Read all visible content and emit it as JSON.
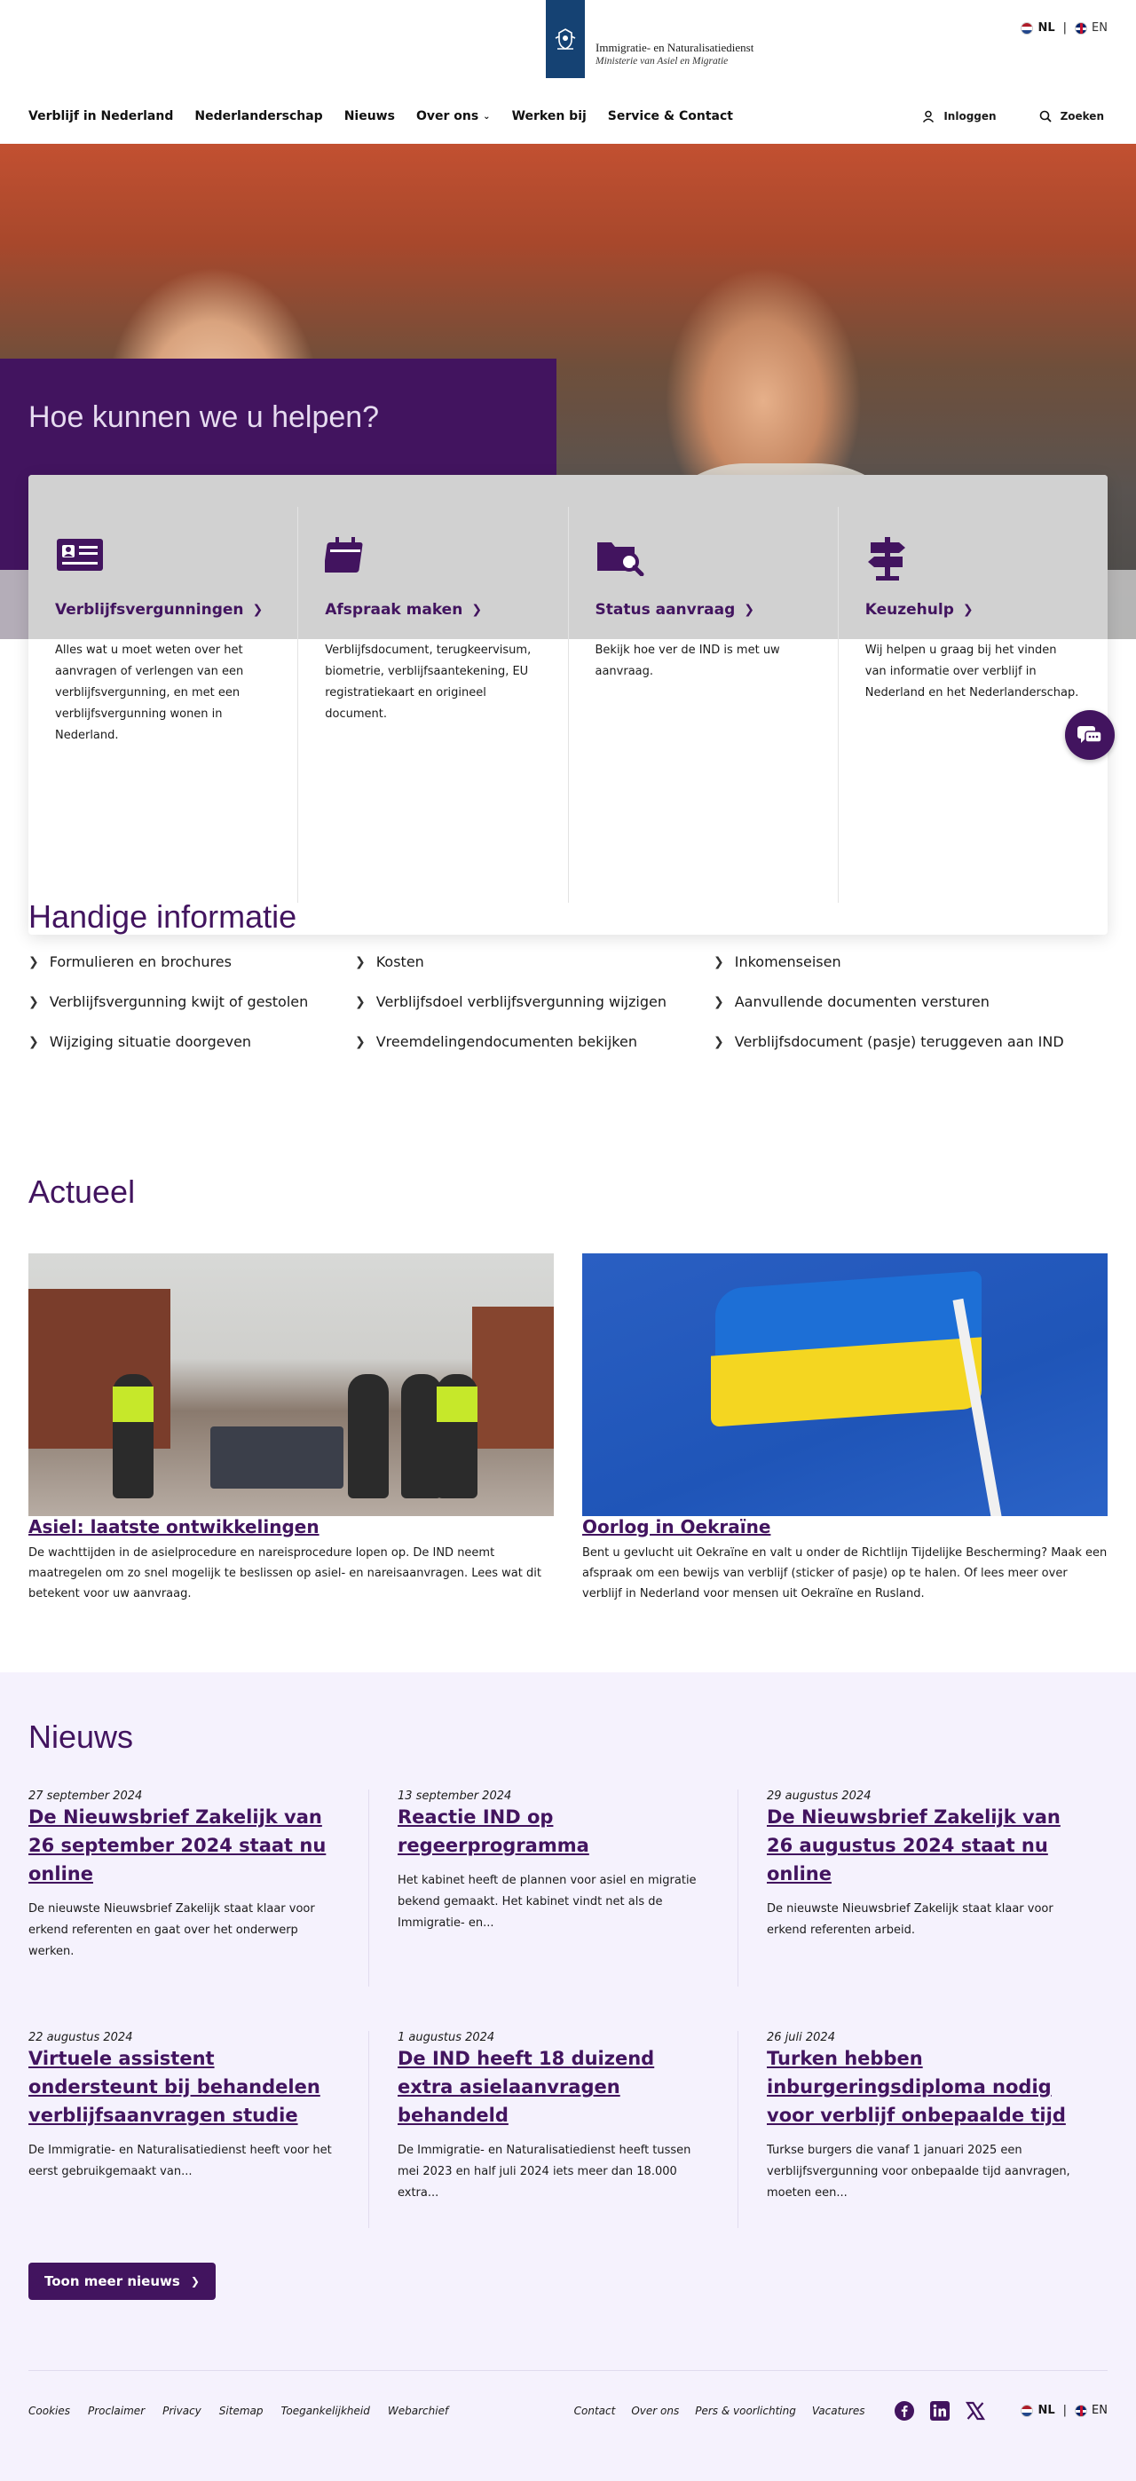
{
  "header": {
    "logo_line1": "Immigratie- en Naturalisatiedienst",
    "logo_line2": "Ministerie van Asiel en Migratie",
    "lang_nl": "NL",
    "lang_en": "EN"
  },
  "nav": {
    "items": [
      "Verblijf in Nederland",
      "Nederlanderschap",
      "Nieuws",
      "Over ons",
      "Werken bij",
      "Service & Contact"
    ],
    "login": "Inloggen",
    "search": "Zoeken"
  },
  "hero": {
    "title": "Hoe kunnen we u helpen?"
  },
  "cards": [
    {
      "title": "Verblijfsvergunningen",
      "desc": "Alles wat u moet weten over het aanvragen of verlengen van een verblijfsvergunning, en met een verblijfsvergunning wonen in Nederland.",
      "icon": "id-card-icon"
    },
    {
      "title": "Afspraak maken",
      "desc": "Verblijfsdocument, terugkeervisum, biometrie, verblijfsaantekening, EU registratiekaart en origineel document.",
      "icon": "calendar-icon"
    },
    {
      "title": "Status aanvraag",
      "desc": "Bekijk hoe ver de IND is met uw aanvraag.",
      "icon": "folder-search-icon"
    },
    {
      "title": "Keuzehulp",
      "desc": "Wij helpen u graag bij het vinden van informatie over verblijf in Nederland en het Nederlanderschap.",
      "icon": "signpost-icon"
    }
  ],
  "handig": {
    "title": "Handige informatie",
    "links": [
      "Formulieren en brochures",
      "Kosten",
      "Inkomenseisen",
      "Verblijfsvergunning kwijt of gestolen",
      "Verblijfsdoel verblijfsvergunning wijzigen",
      "Aanvullende documenten versturen",
      "Wijziging situatie doorgeven",
      "Vreemdelingendocumenten bekijken",
      "Verblijfsdocument (pasje) teruggeven aan IND"
    ]
  },
  "actueel": {
    "title": "Actueel",
    "items": [
      {
        "title": "Asiel: laatste ontwikkelingen",
        "desc": "De wachttijden in de asielprocedure en nareisprocedure lopen op. De IND neemt maatregelen om zo snel mogelijk te beslissen op asiel- en nareisaanvragen. Lees wat dit betekent voor uw aanvraag."
      },
      {
        "title": "Oorlog in Oekraïne",
        "desc": "Bent u gevlucht uit Oekraïne en valt u onder de Richtlijn Tijdelijke Bescherming? Maak een afspraak om een bewijs van verblijf (sticker of pasje) op te halen. Of lees meer over verblijf in Nederland voor mensen uit Oekraïne en Rusland."
      }
    ]
  },
  "nieuws": {
    "title": "Nieuws",
    "items": [
      {
        "date": "27 september 2024",
        "title": "De Nieuwsbrief Zakelijk van 26 september 2024 staat nu online",
        "desc": "De nieuwste Nieuwsbrief Zakelijk staat klaar voor erkend referenten en gaat over het onderwerp werken."
      },
      {
        "date": "13 september 2024",
        "title": "Reactie IND op regeerprogramma",
        "desc": "Het kabinet heeft de plannen voor asiel en migratie bekend gemaakt. Het kabinet vindt net als de Immigratie- en..."
      },
      {
        "date": "29 augustus 2024",
        "title": "De Nieuwsbrief Zakelijk van 26 augustus 2024 staat nu online",
        "desc": "De nieuwste Nieuwsbrief Zakelijk staat klaar voor erkend referenten arbeid."
      },
      {
        "date": "22 augustus 2024",
        "title": "Virtuele assistent ondersteunt bij behandelen verblijfsaanvragen studie",
        "desc": "De Immigratie- en Naturalisatiedienst heeft voor het eerst gebruikgemaakt van..."
      },
      {
        "date": "1 augustus 2024",
        "title": "De IND heeft 18 duizend extra asielaanvragen behandeld",
        "desc": "De Immigratie- en Naturalisatiedienst heeft tussen mei 2023 en half juli 2024 iets meer dan 18.000 extra..."
      },
      {
        "date": "26 juli 2024",
        "title": "Turken hebben inburgeringsdiploma nodig voor verblijf onbepaalde tijd",
        "desc": "Turkse burgers die vanaf 1 januari 2025 een verblijfsvergunning voor onbepaalde tijd aanvragen, moeten een..."
      }
    ],
    "more_label": "Toon meer nieuws"
  },
  "footer": {
    "left": [
      "Cookies",
      "Proclaimer",
      "Privacy",
      "Sitemap",
      "Toegankelijkheid",
      "Webarchief"
    ],
    "right": [
      "Contact",
      "Over ons",
      "Pers & voorlichting",
      "Vacatures"
    ],
    "socials": [
      "facebook-icon",
      "linkedin-icon",
      "x-icon"
    ],
    "lang_nl": "NL",
    "lang_en": "EN"
  },
  "colors": {
    "brand": "#42145f",
    "logo_blue": "#154273",
    "nieuws_bg": "#f5f2fd"
  }
}
